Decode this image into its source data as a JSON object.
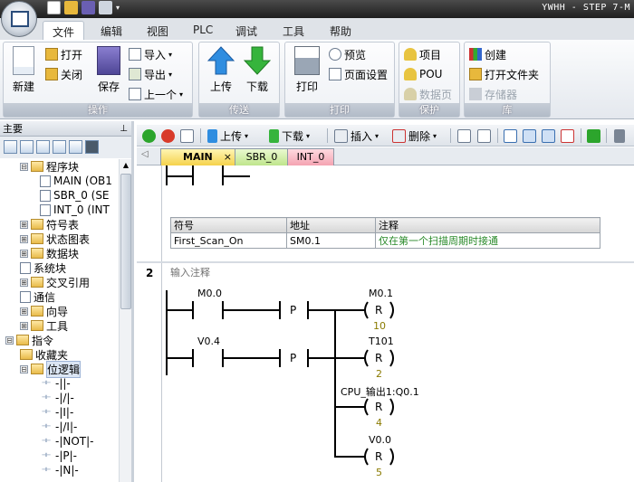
{
  "window": {
    "title": "YWHH - STEP 7-M"
  },
  "ribbon_tabs": [
    "文件",
    "编辑",
    "视图",
    "PLC",
    "调试",
    "工具",
    "帮助"
  ],
  "groups": {
    "ops": {
      "label": "操作",
      "new": "新建",
      "open": "打开",
      "close": "关闭",
      "save": "保存",
      "import": "导入",
      "export": "导出",
      "prev": "上一个"
    },
    "transfer": {
      "label": "传送",
      "upload": "上传",
      "download": "下载"
    },
    "print": {
      "label": "打印",
      "print": "打印",
      "preview": "预览",
      "page_setup": "页面设置"
    },
    "protect": {
      "label": "保护",
      "project": "项目",
      "pou": "POU",
      "datapage": "数据页"
    },
    "library": {
      "label": "库",
      "create": "创建",
      "open_folder": "打开文件夹",
      "memory": "存储器"
    }
  },
  "left_pane": {
    "title": "主要",
    "pin": "⊥"
  },
  "tree": [
    {
      "exp": "⊟",
      "icon": "folder",
      "label": "程序块"
    },
    {
      "icon": "doc",
      "label": "MAIN (OB1"
    },
    {
      "icon": "doc",
      "label": "SBR_0 (SE"
    },
    {
      "icon": "doc",
      "label": "INT_0 (INT"
    },
    {
      "exp": "⊞",
      "icon": "folder",
      "label": "符号表"
    },
    {
      "exp": "⊞",
      "icon": "folder",
      "label": "状态图表"
    },
    {
      "exp": "⊞",
      "icon": "folder",
      "label": "数据块"
    },
    {
      "icon": "doc",
      "label": "系统块"
    },
    {
      "exp": "⊞",
      "icon": "folder",
      "label": "交叉引用"
    },
    {
      "icon": "doc",
      "label": "通信"
    },
    {
      "exp": "⊞",
      "icon": "folder",
      "label": "向导"
    },
    {
      "exp": "⊞",
      "icon": "folder",
      "label": "工具"
    },
    {
      "exp": "⊟",
      "icon": "folder",
      "label": "指令"
    },
    {
      "icon": "folder",
      "label": "收藏夹"
    },
    {
      "exp": "⊟",
      "icon": "folder",
      "label": "位逻辑"
    },
    {
      "icon": "contact",
      "label": "-||-"
    },
    {
      "icon": "contact",
      "label": "-|/|-"
    },
    {
      "icon": "contact",
      "label": "-|I|-"
    },
    {
      "icon": "contact",
      "label": "-|/I|-"
    },
    {
      "icon": "contact",
      "label": "-|NOT|-"
    },
    {
      "icon": "contact",
      "label": "-|P|-"
    },
    {
      "icon": "contact",
      "label": "-|N|-"
    }
  ],
  "toolbar": {
    "upload": "上传",
    "download": "下载",
    "insert": "插入",
    "delete": "删除"
  },
  "pou_tabs": [
    "MAIN",
    "SBR_0",
    "INT_0"
  ],
  "pou_close": "×",
  "symbol_table": {
    "headers": [
      "符号",
      "地址",
      "注释"
    ],
    "row": [
      "First_Scan_On",
      "SM0.1",
      "仅在第一个扫描周期时接通"
    ]
  },
  "network2": {
    "number": "2",
    "comment": "输入注释",
    "contacts": [
      "M0.0",
      "V0.4"
    ],
    "p_label": "P",
    "coils": [
      {
        "addr": "M0.1",
        "type": "R",
        "n": "10"
      },
      {
        "addr": "T101",
        "type": "R",
        "n": "2"
      },
      {
        "addr": "CPU_输出1:Q0.1",
        "type": "R",
        "n": "4"
      },
      {
        "addr": "V0.0",
        "type": "R",
        "n": "5"
      }
    ]
  }
}
